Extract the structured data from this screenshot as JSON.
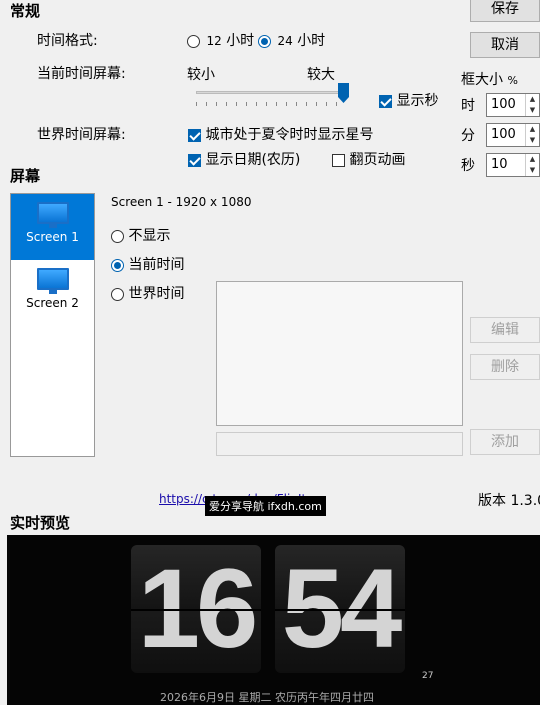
{
  "general": {
    "section_title": "常规",
    "time_format_label": "时间格式:",
    "format_12_num": "12",
    "format_12_unit": "小时",
    "format_24_num": "24",
    "format_24_unit": "小时",
    "current_time_screen_label": "当前时间屏幕:",
    "size_small": "较小",
    "size_large": "较大",
    "show_seconds": "显示秒",
    "world_time_screen_label": "世界时间屏幕:",
    "dst_star": "城市处于夏令时时显示星号",
    "show_date": "显示日期(农历)",
    "flip_animation": "翻页动画"
  },
  "buttons": {
    "save": "保存",
    "cancel": "取消",
    "edit": "编辑",
    "delete": "删除",
    "add": "添加"
  },
  "frame_size": {
    "title": "框大小",
    "unit": "%",
    "hour_label": "时",
    "hour_value": "100",
    "minute_label": "分",
    "minute_value": "100",
    "second_label": "秒",
    "second_value": "10"
  },
  "screens": {
    "section_title": "屏幕",
    "items": [
      {
        "label": "Screen 1"
      },
      {
        "label": "Screen 2"
      }
    ],
    "selected_info": "Screen 1 - 1920 x 1080",
    "options": {
      "none": "不显示",
      "current": "当前时间",
      "world": "世界时间"
    }
  },
  "footer": {
    "link_text": "https://c           tor.co/den/FlipIt",
    "watermark": "爱分享导航 ifxdh.com",
    "version": "版本 1.3.0"
  },
  "preview": {
    "section_title": "实时预览",
    "hours": "16",
    "minutes": "54",
    "seconds": "27",
    "date_line": "2026年6月9日  星期二  农历丙午年四月廿四"
  },
  "colors": {
    "accent": "#0078d7",
    "preview_bg": "#050505",
    "digit": "#d4d4d4"
  }
}
